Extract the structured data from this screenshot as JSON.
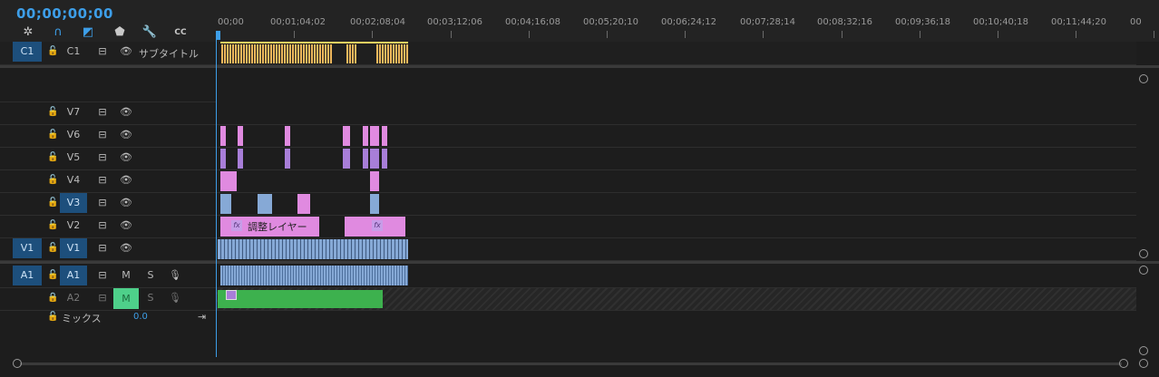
{
  "timecode": "00;00;00;00",
  "ruler_labels": [
    "00;00",
    "00;01;04;02",
    "00;02;08;04",
    "00;03;12;06",
    "00;04;16;08",
    "00;05;20;10",
    "00;06;24;12",
    "00;07;28;14",
    "00;08;32;16",
    "00;09;36;18",
    "00;10;40;18",
    "00;11;44;20",
    "00"
  ],
  "caption_track": {
    "src": "C1",
    "name": "C1",
    "label": "サブタイトル"
  },
  "video_tracks": [
    {
      "name": "V7",
      "selected": false
    },
    {
      "name": "V6",
      "selected": false
    },
    {
      "name": "V5",
      "selected": false
    },
    {
      "name": "V4",
      "selected": false
    },
    {
      "name": "V3",
      "selected": true
    },
    {
      "name": "V2",
      "selected": false
    },
    {
      "name": "V1",
      "selected": true,
      "src": "V1"
    }
  ],
  "audio_tracks": [
    {
      "src": "A1",
      "name": "A1",
      "m": "M",
      "s": "S"
    },
    {
      "src": "",
      "name": "A2",
      "m": "M",
      "s": "S"
    }
  ],
  "mix": {
    "label": "ミックス",
    "value": "0.0"
  },
  "clips": {
    "adjustment_label": "調整レイヤー",
    "fx": "fx"
  },
  "colors": {
    "accent": "#3d9ee8",
    "selected_track": "#1d4f7c",
    "adjustment": "#e08ae0",
    "video": "#86a9d6",
    "audio_green": "#3db14e",
    "captions": "#f0b85c"
  }
}
